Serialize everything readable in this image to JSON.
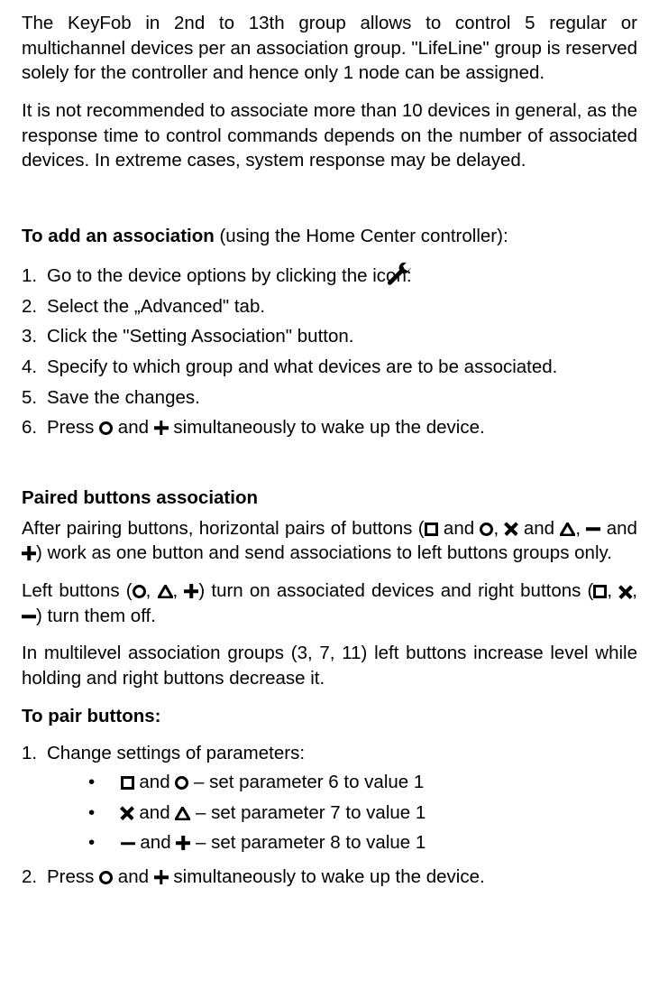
{
  "intro": {
    "p1": "The KeyFob in 2nd to 13th group allows to control 5 regular or multichannel devices per an association group. \"LifeLine\" group is reserved solely for the controller and hence only 1 node can  be assigned.",
    "p2": "It is not recommended to associate more than 10 devices in general, as the response time to control commands depends on the number of associated devices. In extreme cases, system response may be delayed."
  },
  "add_assoc": {
    "heading_bold": "To add an association",
    "heading_rest": " (using the Home Center controller):",
    "step1": "Go to the device options by clicking the icon:",
    "step2": "Select the „Advanced\" tab.",
    "step3": "Click the \"Setting Association\" button.",
    "step4": "Specify to which group and what devices are to be associated.",
    "step5": "Save the changes.",
    "step6_a": "Press ",
    "step6_b": " and ",
    "step6_c": " simultaneously to wake up the device."
  },
  "paired": {
    "heading": "Paired buttons association",
    "p1_a": "After pairing buttons, horizontal pairs of buttons (",
    "p1_b": " and ",
    "p1_c": ", ",
    "p1_d": " and ",
    "p1_e": ", ",
    "p1_f": " and ",
    "p1_g": ") work as one button and send associations to left buttons groups only.",
    "p2_a": "Left buttons (",
    "p2_b": ", ",
    "p2_c": ", ",
    "p2_d": ") turn on associated devices and right buttons (",
    "p2_e": ", ",
    "p2_f": ", ",
    "p2_g": ") turn them off.",
    "p3": "In multilevel association groups (3, 7, 11) left buttons increase level while holding and right buttons decrease it.",
    "to_pair": "To pair buttons:",
    "step1": "Change settings of parameters:",
    "b1_a": " and ",
    "b1_b": " – set parameter 6 to value 1",
    "b2_a": " and ",
    "b2_b": " – set parameter 7 to value 1",
    "b3_a": " and ",
    "b3_b": " – set parameter 8 to value 1",
    "step2_a": "Press ",
    "step2_b": " and ",
    "step2_c": " simultaneously to wake up the device."
  },
  "numbers": {
    "n1": "1.",
    "n2": "2.",
    "n3": "3.",
    "n4": "4.",
    "n5": "5.",
    "n6": "6."
  }
}
